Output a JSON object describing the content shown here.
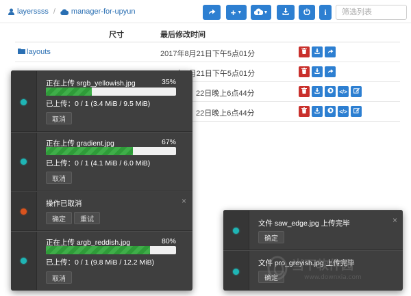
{
  "breadcrumb": {
    "root": "layerssss",
    "bucket": "manager-for-upyun"
  },
  "toolbar": {
    "filter_placeholder": "筛选列表"
  },
  "table": {
    "headers": {
      "size": "尺寸",
      "modified": "最后修改时间"
    },
    "rows": [
      {
        "name": "layouts",
        "date": "2017年8月21日下午5点01分"
      },
      {
        "name": "",
        "date": "2017年8月21日下午5点01分"
      },
      {
        "name": "",
        "date": "22日晚上6点44分"
      },
      {
        "name": "",
        "date": "22日晚上6点44分"
      }
    ]
  },
  "uploads": [
    {
      "title": "正在上传 srgb_yellowish.jpg",
      "percent": "35%",
      "progress": 0.35,
      "detail": "已上传：0 / 1 (3.4 MiB / 9.5 MiB)",
      "button": "取消"
    },
    {
      "title": "正在上传 gradient.jpg",
      "percent": "67%",
      "progress": 0.67,
      "detail": "已上传：0 / 1 (4.1 MiB / 6.0 MiB)",
      "button": "取消"
    },
    {
      "title": "操作已取消",
      "btn_ok": "确定",
      "btn_retry": "重试"
    },
    {
      "title": "正在上传 argb_reddish.jpg",
      "percent": "80%",
      "progress": 0.8,
      "detail": "已上传：0 / 1 (9.8 MiB / 12.2 MiB)",
      "button": "取消"
    }
  ],
  "notices": [
    {
      "title": "文件 saw_edge.jpg 上传完毕",
      "button": "确定"
    },
    {
      "title": "文件 pro_greyish.jpg 上传完毕",
      "button": "确定"
    }
  ],
  "watermark": {
    "brand": "当下软件园",
    "url": "www.downxia.com"
  },
  "colors": {
    "accent": "#2d7fd1",
    "danger": "#c9302c",
    "progress": "#3fae49",
    "panel": "#3f3f3f"
  }
}
